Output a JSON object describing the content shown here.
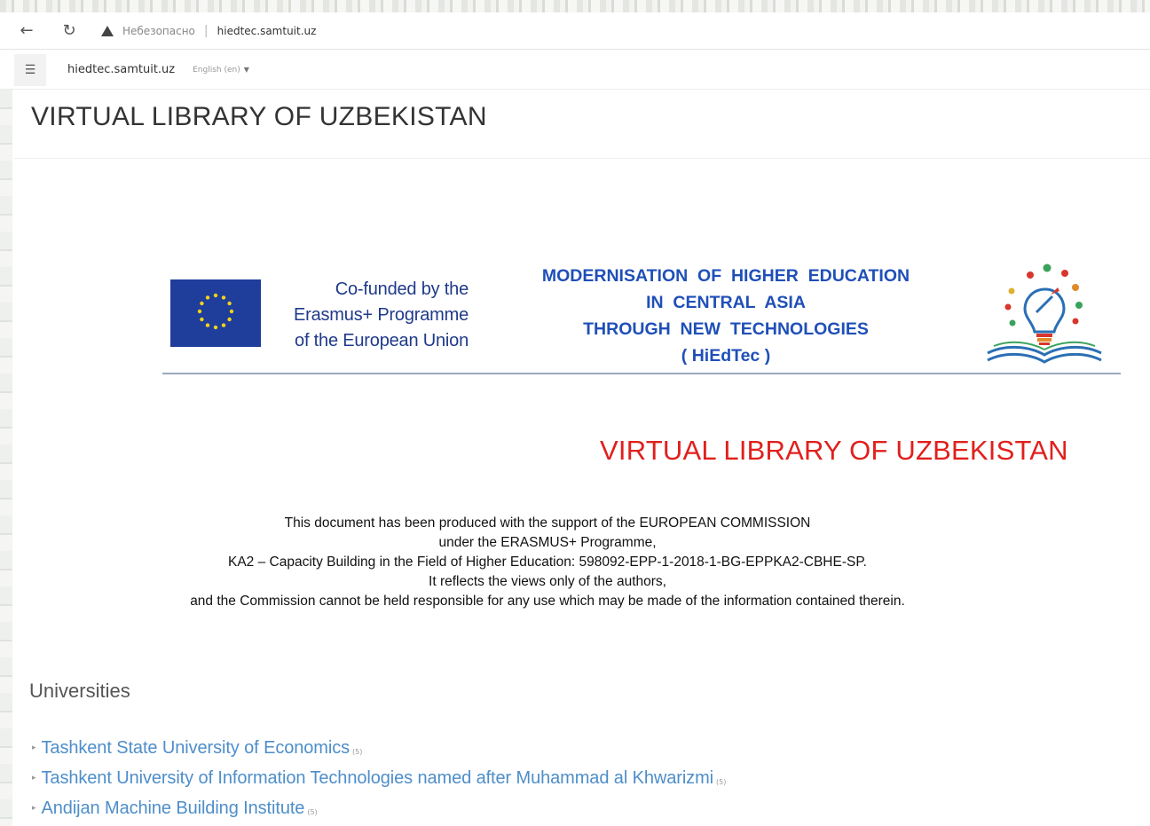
{
  "browser": {
    "security_label": "Небезопасно",
    "separator": "|",
    "url": "hiedtec.samtuit.uz"
  },
  "navbar": {
    "site_name": "hiedtec.samtuit.uz",
    "language": "English (en)"
  },
  "header": {
    "title": "VIRTUAL LIBRARY OF UZBEKISTAN"
  },
  "banner": {
    "cofund_lines": [
      "Co-funded by the",
      "Erasmus+ Programme",
      "of the European Union"
    ],
    "project_lines": [
      "MODERNISATION  OF  HIGHER  EDUCATION",
      "IN  CENTRAL  ASIA",
      "THROUGH  NEW  TECHNOLOGIES",
      "( HiEdTec )"
    ],
    "accent_blue": "#1f4fb8",
    "flag_blue": "#1f3d9b"
  },
  "library_title": "VIRTUAL LIBRARY OF UZBEKISTAN",
  "library_title_color": "#e0201d",
  "disclaimer": {
    "lines": [
      "This document has been produced with the support of the EUROPEAN COMMISSION",
      "under the ERASMUS+ Programme,",
      "KA2 – Capacity Building in the Field of Higher Education: 598092-EPP-1-2018-1-BG-EPPKA2-CBHE-SP.",
      "It reflects the views only of the authors,",
      "and the Commission cannot be held responsible for any use which may be made of the information contained therein."
    ]
  },
  "universities": {
    "heading": "Universities",
    "link_color": "#4e8ec9",
    "items": [
      {
        "name": "Tashkent State University of Economics",
        "count": "(5)"
      },
      {
        "name": "Tashkent University of Information Technologies named after Muhammad al Khwarizmi",
        "count": "(5)"
      },
      {
        "name": "Andijan Machine Building Institute",
        "count": "(5)"
      }
    ]
  }
}
